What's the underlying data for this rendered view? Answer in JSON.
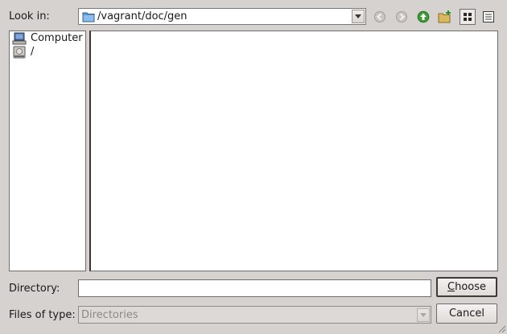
{
  "dialog": {
    "look_in_label": "Look in:",
    "look_in_path": "/vagrant/doc/gen",
    "toolbar": {
      "back_icon": "back-arrow-icon",
      "forward_icon": "forward-arrow-icon",
      "up_icon": "up-arrow-icon",
      "new_folder_icon": "new-folder-icon",
      "list_view_icon": "list-view-icon",
      "detail_view_icon": "detail-view-icon"
    },
    "sidebar": {
      "items": [
        {
          "label": "Computer",
          "icon": "computer-icon"
        },
        {
          "label": "/",
          "icon": "drive-icon"
        }
      ]
    },
    "directory_label": "Directory:",
    "directory_value": "",
    "choose_button": "Choose",
    "choose_mnemonic": "C",
    "choose_rest": "hoose",
    "files_of_type_label": "Files of type:",
    "files_of_type_value": "Directories",
    "cancel_button": "Cancel"
  },
  "colors": {
    "window_bg": "#d6d2d0",
    "up_arrow_green": "#3d9b35",
    "folder_blue": "#4a88c8"
  }
}
